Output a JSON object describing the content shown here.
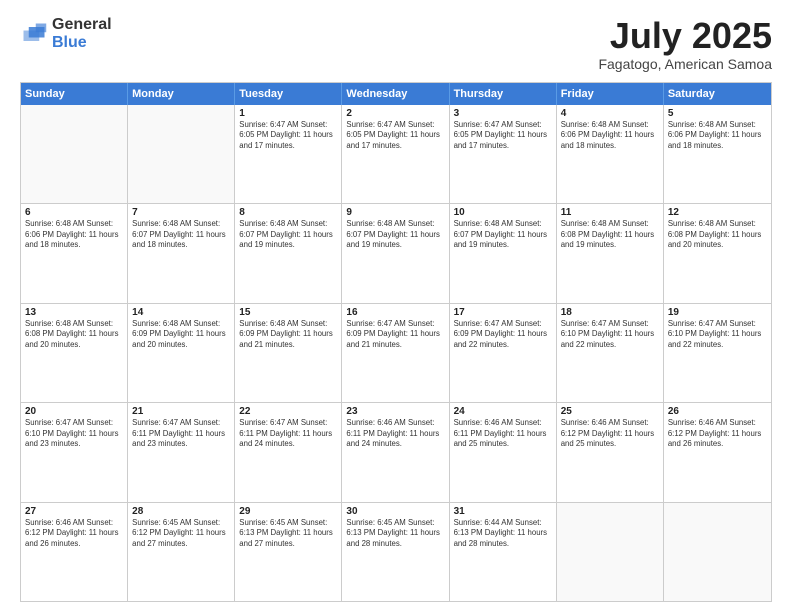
{
  "logo": {
    "general": "General",
    "blue": "Blue"
  },
  "title": "July 2025",
  "subtitle": "Fagatogo, American Samoa",
  "days": [
    "Sunday",
    "Monday",
    "Tuesday",
    "Wednesday",
    "Thursday",
    "Friday",
    "Saturday"
  ],
  "weeks": [
    [
      {
        "num": "",
        "info": "",
        "empty": true
      },
      {
        "num": "",
        "info": "",
        "empty": true
      },
      {
        "num": "1",
        "info": "Sunrise: 6:47 AM\nSunset: 6:05 PM\nDaylight: 11 hours and 17 minutes."
      },
      {
        "num": "2",
        "info": "Sunrise: 6:47 AM\nSunset: 6:05 PM\nDaylight: 11 hours and 17 minutes."
      },
      {
        "num": "3",
        "info": "Sunrise: 6:47 AM\nSunset: 6:05 PM\nDaylight: 11 hours and 17 minutes."
      },
      {
        "num": "4",
        "info": "Sunrise: 6:48 AM\nSunset: 6:06 PM\nDaylight: 11 hours and 18 minutes."
      },
      {
        "num": "5",
        "info": "Sunrise: 6:48 AM\nSunset: 6:06 PM\nDaylight: 11 hours and 18 minutes."
      }
    ],
    [
      {
        "num": "6",
        "info": "Sunrise: 6:48 AM\nSunset: 6:06 PM\nDaylight: 11 hours and 18 minutes."
      },
      {
        "num": "7",
        "info": "Sunrise: 6:48 AM\nSunset: 6:07 PM\nDaylight: 11 hours and 18 minutes."
      },
      {
        "num": "8",
        "info": "Sunrise: 6:48 AM\nSunset: 6:07 PM\nDaylight: 11 hours and 19 minutes."
      },
      {
        "num": "9",
        "info": "Sunrise: 6:48 AM\nSunset: 6:07 PM\nDaylight: 11 hours and 19 minutes."
      },
      {
        "num": "10",
        "info": "Sunrise: 6:48 AM\nSunset: 6:07 PM\nDaylight: 11 hours and 19 minutes."
      },
      {
        "num": "11",
        "info": "Sunrise: 6:48 AM\nSunset: 6:08 PM\nDaylight: 11 hours and 19 minutes."
      },
      {
        "num": "12",
        "info": "Sunrise: 6:48 AM\nSunset: 6:08 PM\nDaylight: 11 hours and 20 minutes."
      }
    ],
    [
      {
        "num": "13",
        "info": "Sunrise: 6:48 AM\nSunset: 6:08 PM\nDaylight: 11 hours and 20 minutes."
      },
      {
        "num": "14",
        "info": "Sunrise: 6:48 AM\nSunset: 6:09 PM\nDaylight: 11 hours and 20 minutes."
      },
      {
        "num": "15",
        "info": "Sunrise: 6:48 AM\nSunset: 6:09 PM\nDaylight: 11 hours and 21 minutes."
      },
      {
        "num": "16",
        "info": "Sunrise: 6:47 AM\nSunset: 6:09 PM\nDaylight: 11 hours and 21 minutes."
      },
      {
        "num": "17",
        "info": "Sunrise: 6:47 AM\nSunset: 6:09 PM\nDaylight: 11 hours and 22 minutes."
      },
      {
        "num": "18",
        "info": "Sunrise: 6:47 AM\nSunset: 6:10 PM\nDaylight: 11 hours and 22 minutes."
      },
      {
        "num": "19",
        "info": "Sunrise: 6:47 AM\nSunset: 6:10 PM\nDaylight: 11 hours and 22 minutes."
      }
    ],
    [
      {
        "num": "20",
        "info": "Sunrise: 6:47 AM\nSunset: 6:10 PM\nDaylight: 11 hours and 23 minutes."
      },
      {
        "num": "21",
        "info": "Sunrise: 6:47 AM\nSunset: 6:11 PM\nDaylight: 11 hours and 23 minutes."
      },
      {
        "num": "22",
        "info": "Sunrise: 6:47 AM\nSunset: 6:11 PM\nDaylight: 11 hours and 24 minutes."
      },
      {
        "num": "23",
        "info": "Sunrise: 6:46 AM\nSunset: 6:11 PM\nDaylight: 11 hours and 24 minutes."
      },
      {
        "num": "24",
        "info": "Sunrise: 6:46 AM\nSunset: 6:11 PM\nDaylight: 11 hours and 25 minutes."
      },
      {
        "num": "25",
        "info": "Sunrise: 6:46 AM\nSunset: 6:12 PM\nDaylight: 11 hours and 25 minutes."
      },
      {
        "num": "26",
        "info": "Sunrise: 6:46 AM\nSunset: 6:12 PM\nDaylight: 11 hours and 26 minutes."
      }
    ],
    [
      {
        "num": "27",
        "info": "Sunrise: 6:46 AM\nSunset: 6:12 PM\nDaylight: 11 hours and 26 minutes."
      },
      {
        "num": "28",
        "info": "Sunrise: 6:45 AM\nSunset: 6:12 PM\nDaylight: 11 hours and 27 minutes."
      },
      {
        "num": "29",
        "info": "Sunrise: 6:45 AM\nSunset: 6:13 PM\nDaylight: 11 hours and 27 minutes."
      },
      {
        "num": "30",
        "info": "Sunrise: 6:45 AM\nSunset: 6:13 PM\nDaylight: 11 hours and 28 minutes."
      },
      {
        "num": "31",
        "info": "Sunrise: 6:44 AM\nSunset: 6:13 PM\nDaylight: 11 hours and 28 minutes."
      },
      {
        "num": "",
        "info": "",
        "empty": true
      },
      {
        "num": "",
        "info": "",
        "empty": true
      }
    ]
  ]
}
